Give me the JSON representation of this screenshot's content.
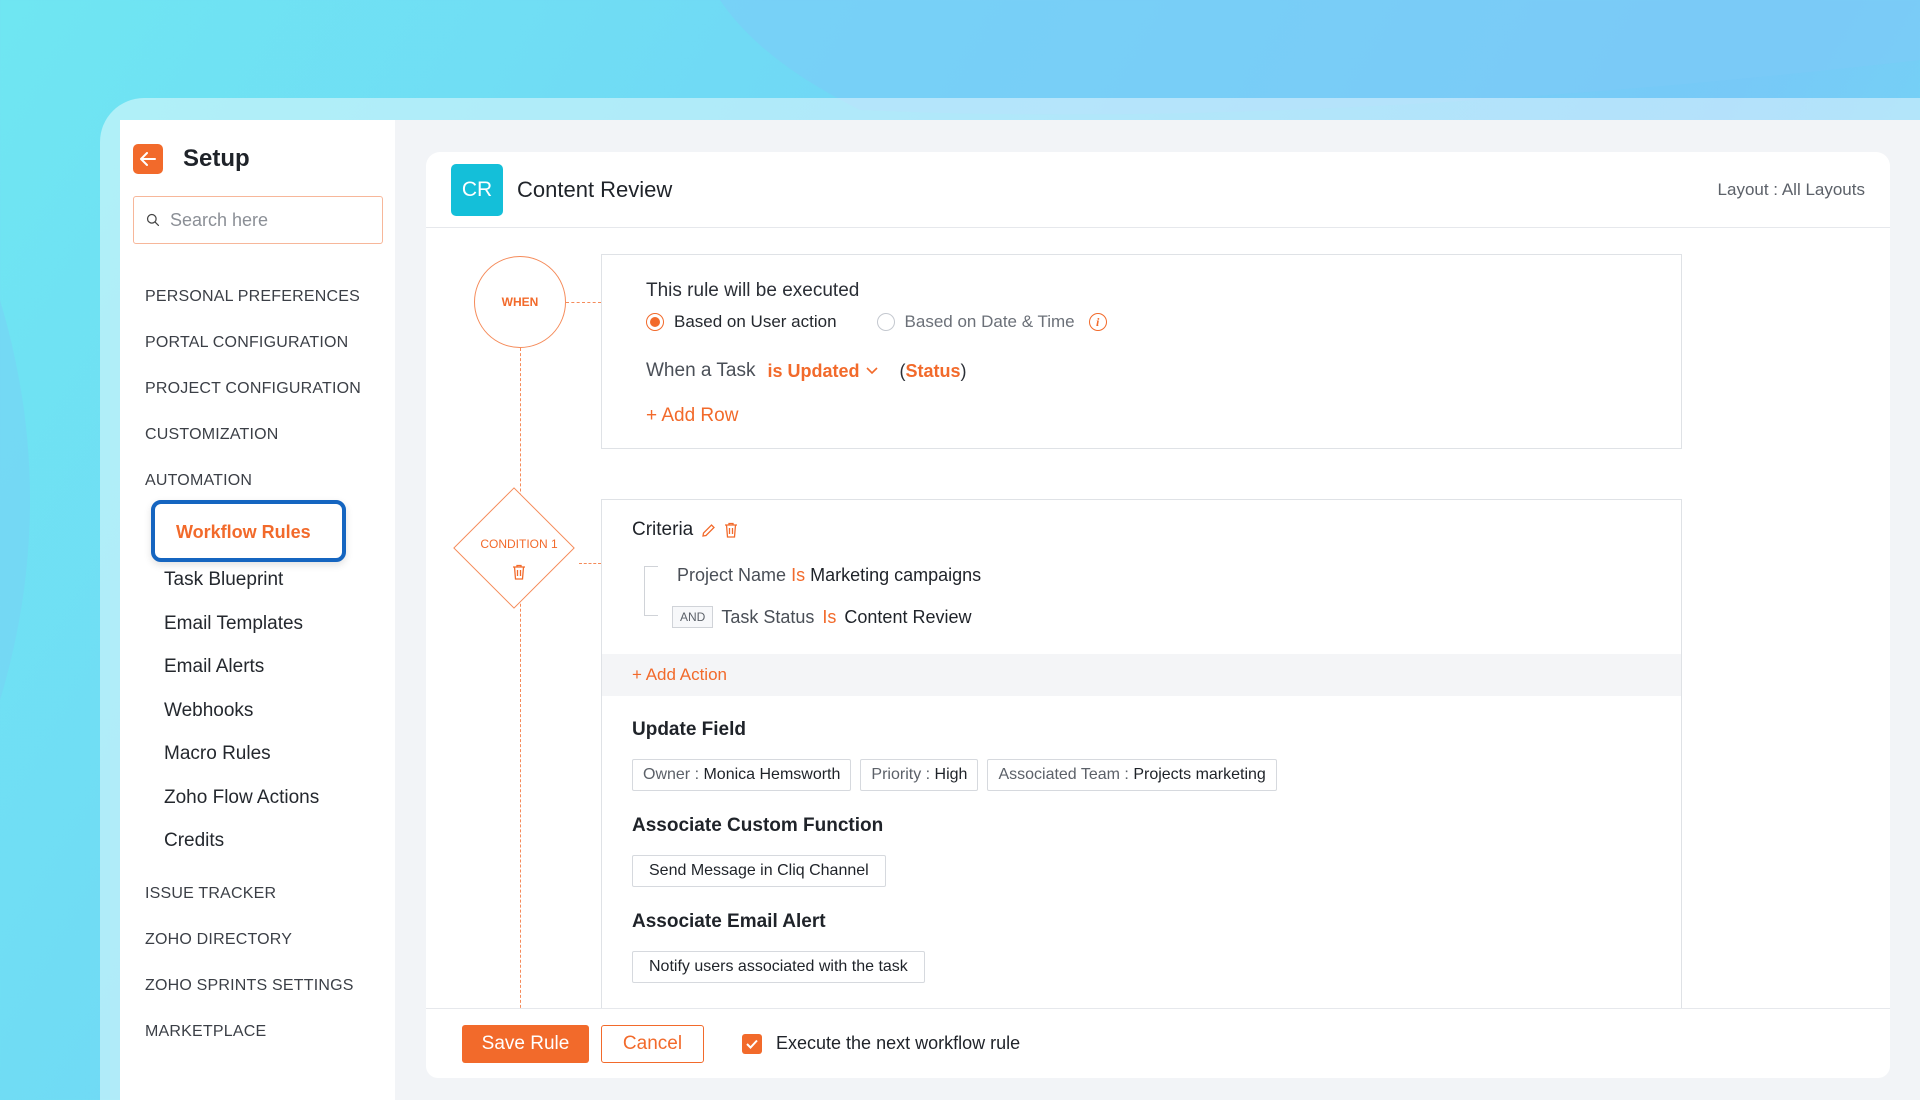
{
  "sidebar": {
    "title": "Setup",
    "search_placeholder": "Search here",
    "sections_top": [
      "PERSONAL PREFERENCES",
      "PORTAL CONFIGURATION",
      "PROJECT CONFIGURATION",
      "CUSTOMIZATION",
      "AUTOMATION"
    ],
    "automation_items": [
      "Workflow Rules",
      "Task Blueprint",
      "Email Templates",
      "Email Alerts",
      "Webhooks",
      "Macro Rules",
      "Zoho Flow Actions",
      "Credits"
    ],
    "active_item": "Workflow Rules",
    "sections_bottom": [
      "ISSUE TRACKER",
      "ZOHO DIRECTORY",
      "ZOHO SPRINTS SETTINGS",
      "MARKETPLACE"
    ]
  },
  "header": {
    "badge": "CR",
    "title": "Content Review",
    "layout_label": "Layout :",
    "layout_value": "All Layouts"
  },
  "when": {
    "node_label": "WHEN",
    "title": "This rule will be executed",
    "option_user": "Based on User action",
    "option_date": "Based on Date & Time",
    "selected": "Based on User action",
    "row_prefix": "When a Task",
    "row_operator": "is Updated",
    "row_field_open": "(",
    "row_field": "Status",
    "row_field_close": ")",
    "add_row": "Add Row"
  },
  "condition": {
    "node_label": "CONDITION 1",
    "criteria_title": "Criteria",
    "c1_field": "Project Name",
    "c1_op": "Is",
    "c1_value": "Marketing campaigns",
    "c2_join": "AND",
    "c2_field": "Task Status",
    "c2_op": "Is",
    "c2_value": "Content Review",
    "add_action": "+ Add Action",
    "update_field_title": "Update Field",
    "update_fields": [
      {
        "key": "Owner :",
        "value": "Monica Hemsworth"
      },
      {
        "key": "Priority :",
        "value": "High"
      },
      {
        "key": "Associated Team :",
        "value": "Projects marketing"
      }
    ],
    "custom_function_title": "Associate Custom Function",
    "custom_function": "Send Message in Cliq Channel",
    "email_alert_title": "Associate Email Alert",
    "email_alert": "Notify users associated with the task"
  },
  "footer": {
    "save": "Save Rule",
    "cancel": "Cancel",
    "checkbox_label": "Execute the next workflow rule",
    "checkbox_checked": true
  },
  "colors": {
    "accent": "#f26a2b",
    "badge": "#14bfd9",
    "highlight_border": "#1565c0"
  }
}
